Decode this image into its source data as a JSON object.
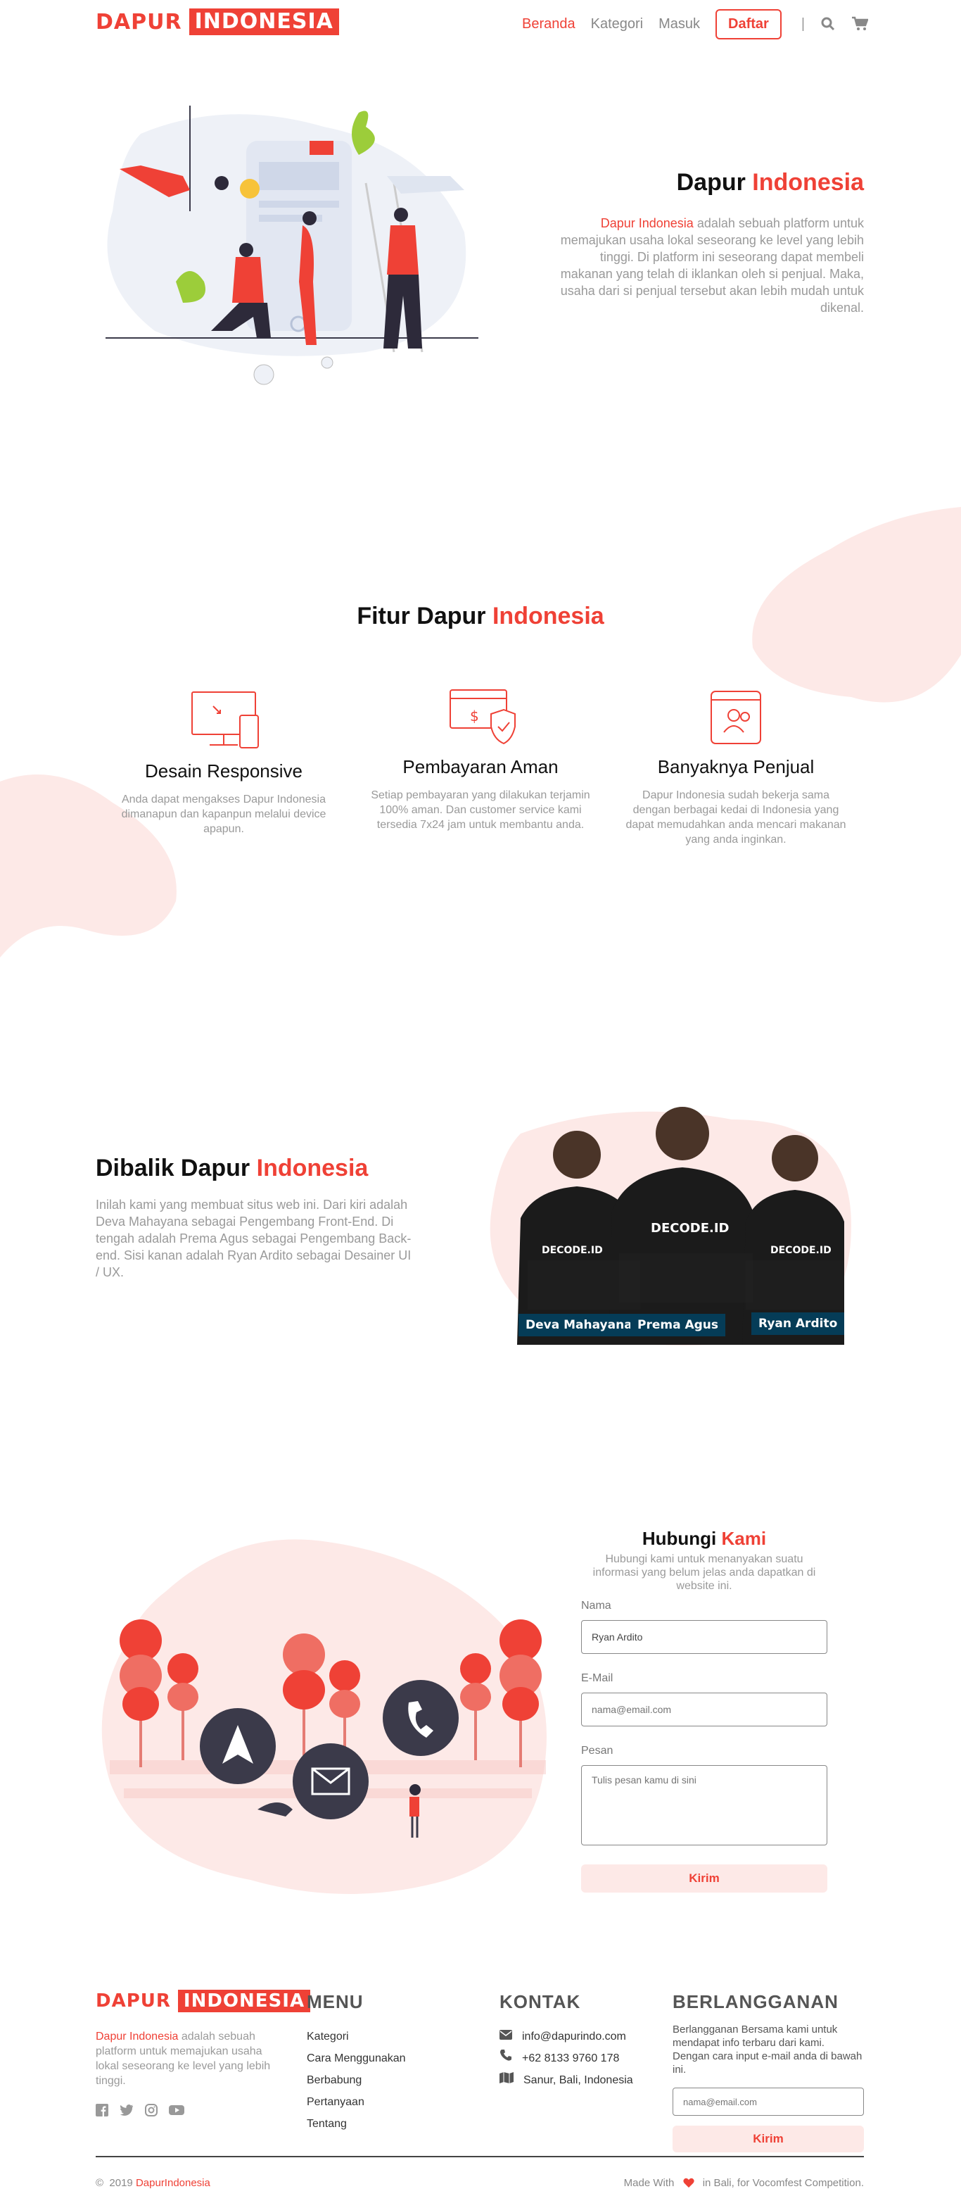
{
  "brand": {
    "logo_left": "DAPUR",
    "logo_right": "INDONESIA"
  },
  "nav": {
    "beranda": "Beranda",
    "kategori": "Kategori",
    "masuk": "Masuk",
    "daftar": "Daftar",
    "separator": "|"
  },
  "hero": {
    "title_a": "Dapur",
    "title_b": "Indonesia",
    "desc_highlight": "Dapur Indonesia",
    "desc": "adalah sebuah platform untuk memajukan usaha lokal seseorang ke level yang lebih tinggi. Di platform ini seseorang dapat membeli makanan yang telah di iklankan oleh si penjual. Maka, usaha dari si penjual tersebut akan lebih mudah untuk dikenal."
  },
  "features": {
    "title_a": "Fitur Dapur",
    "title_b": "Indonesia",
    "items": [
      {
        "icon": "responsive-icon",
        "title": "Desain Responsive",
        "desc": "Anda dapat mengakses Dapur Indonesia dimanapun dan kapanpun melalui device apapun."
      },
      {
        "icon": "payment-icon",
        "title": "Pembayaran Aman",
        "desc": "Setiap pembayaran yang dilakukan terjamin 100% aman. Dan customer service kami tersedia 7x24 jam untuk membantu anda."
      },
      {
        "icon": "seller-icon",
        "title": "Banyaknya Penjual",
        "desc": "Dapur Indonesia sudah bekerja sama dengan berbagai kedai di Indonesia yang dapat memudahkan anda mencari makanan yang anda inginkan."
      }
    ]
  },
  "team": {
    "title_a": "Dibalik Dapur",
    "title_b": "Indonesia",
    "desc": "Inilah kami yang membuat situs web ini. Dari kiri adalah Deva Mahayana sebagai Pengembang Front-End. Di tengah adalah Prema Agus sebagai Pengembang Back-end. Sisi kanan adalah Ryan Ardito sebagai Desainer UI / UX.",
    "members": [
      "Deva Mahayana",
      "Prema Agus",
      "Ryan Ardito"
    ],
    "shirt_text": "DECODE.ID"
  },
  "contact": {
    "title_a": "Hubungi",
    "title_b": "Kami",
    "subtitle": "Hubungi kami untuk menanyakan suatu informasi yang belum jelas anda dapatkan di website ini.",
    "name_label": "Nama",
    "name_value": "Ryan Ardito",
    "email_label": "E-Mail",
    "email_placeholder": "nama@email.com",
    "message_label": "Pesan",
    "message_placeholder": "Tulis pesan kamu di sini",
    "submit": "Kirim"
  },
  "footer": {
    "about_highlight": "Dapur Indonesia",
    "about": "adalah sebuah platform untuk memajukan usaha lokal seseorang ke level yang lebih tinggi.",
    "social_icons": [
      "facebook-icon",
      "twitter-icon",
      "instagram-icon",
      "youtube-icon"
    ],
    "menu_title": "MENU",
    "menu": [
      "Kategori",
      "Cara Menggunakan",
      "Berbabung",
      "Pertanyaan",
      "Tentang"
    ],
    "contact_title": "KONTAK",
    "email": "info@dapurindo.com",
    "phone": "+62 8133 9760 178",
    "address": "Sanur, Bali, Indonesia",
    "subscribe_title": "BERLANGGANAN",
    "subscribe_desc": "Berlangganan Bersama kami untuk mendapat info terbaru dari kami. Dengan cara input e-mail anda di bawah ini.",
    "subscribe_placeholder": "nama@email.com",
    "subscribe_button": "Kirim",
    "copyright_symbol": "©",
    "copyright_year": "2019",
    "copyright_brand": "DapurIndonesia",
    "made_with": "Made With",
    "made_after": "in Bali, for Vocomfest Competition."
  },
  "colors": {
    "accent": "#ef4136",
    "blob": "#fde9e7",
    "dark": "#3b3a4a",
    "navy": "#053c57"
  }
}
